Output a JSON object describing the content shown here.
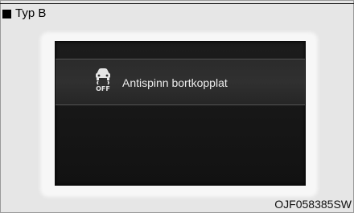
{
  "caption": {
    "label": "Typ B"
  },
  "display": {
    "icon": "traction-control-off-icon",
    "icon_sub_label": "OFF",
    "message": "Antispinn bortkopplat"
  },
  "footer": {
    "image_code": "OJF058385SW"
  },
  "colors": {
    "display_background": "#141414",
    "message_band": "#2d2d2d",
    "text": "#ececec",
    "frame_background": "#e6e6e6"
  }
}
